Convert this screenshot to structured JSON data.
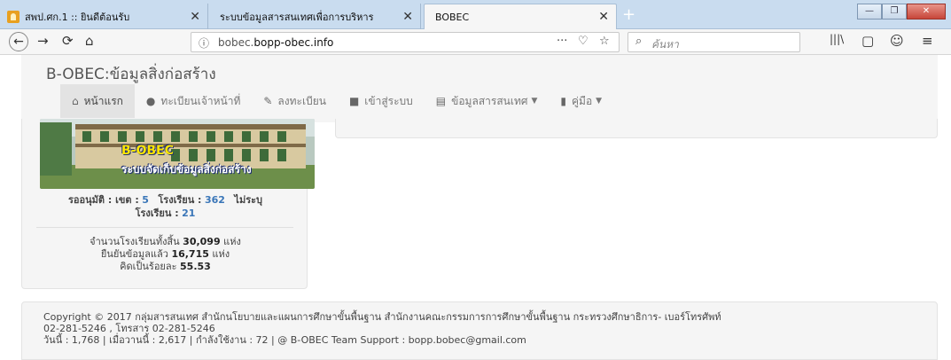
{
  "browser": {
    "tabs": [
      {
        "title": "สพป.ศก.1 :: ยินดีต้อนรับ",
        "active": false
      },
      {
        "title": "ระบบข้อมูลสารสนเทศเพื่อการบริหาร",
        "active": false
      },
      {
        "title": "BOBEC",
        "active": true
      }
    ],
    "url_prefix": "bobec.",
    "url_domain": "bopp-obec.info",
    "search_placeholder": "ค้นหา"
  },
  "site": {
    "brand": "B-OBEC:ข้อมูลสิ่งก่อสร้าง",
    "menu": [
      {
        "label": "หน้าแรก",
        "icon": "home-icon",
        "active": true
      },
      {
        "label": "ทะเบียนเจ้าหน้าที่",
        "icon": "user-icon",
        "active": false
      },
      {
        "label": "ลงทะเบียน",
        "icon": "edit-icon",
        "active": false
      },
      {
        "label": "เข้าสู่ระบบ",
        "icon": "lock-icon",
        "active": false
      },
      {
        "label": "ข้อมูลสารสนเทศ",
        "icon": "list-icon",
        "active": false,
        "dropdown": true
      },
      {
        "label": "คู่มือ",
        "icon": "book-icon",
        "active": false,
        "dropdown": true
      }
    ]
  },
  "banner": {
    "logo_text": "B-OBEC",
    "subtitle": "ระบบจัดเก็บข้อมูลสิ่งก่อสร้าง"
  },
  "stats": {
    "pending_label": "รออนุมัติ : เขต :",
    "district_count": "5",
    "school_label": "โรงเรียน :",
    "school_count": "362",
    "unspecified_label": "ไม่ระบุ",
    "unspecified_school_label": "โรงเรียน :",
    "unspecified_school_count": "21"
  },
  "summary": {
    "total_prefix": "จำนวนโรงเรียนทั้งสิ้น",
    "total_value": "30,099",
    "total_unit": "แห่ง",
    "confirmed_prefix": "ยืนยันข้อมูลแล้ว",
    "confirmed_value": "16,715",
    "confirmed_unit": "แห่ง",
    "percent_prefix": "คิดเป็นร้อยละ",
    "percent_value": "55.53"
  },
  "footer": {
    "copyright": "Copyright © 2017 กลุ่มสารสนเทศ สำนักนโยบายและแผนการศึกษาขั้นพื้นฐาน สำนักงานคณะกรรมการการศึกษาขั้นพื้นฐาน กระทรวงศึกษาธิการ- เบอร์โทรศัพท์",
    "phone_line": "02-281-5246 , โทรสาร 02-281-5246",
    "stats_line": "วันนี้ : 1,768 | เมื่อวานนี้ : 2,617 | กำลังใช้งาน : 72 | @ B-OBEC Team Support : bopp.bobec@gmail.com"
  }
}
